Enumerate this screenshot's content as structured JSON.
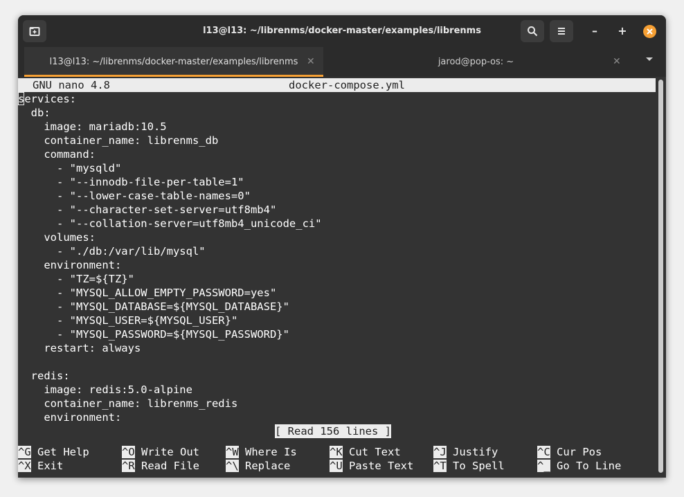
{
  "window": {
    "title": "l13@l13: ~/librenms/docker-master/examples/librenms",
    "accent": "#f6a034"
  },
  "titlebar_buttons": [
    "new-tab-icon",
    "search-icon",
    "menu-icon"
  ],
  "window_controls": {
    "minimize": "–",
    "maximize": "+"
  },
  "tabs": [
    {
      "label": "l13@l13: ~/librenms/docker-master/examples/librenms",
      "active": true
    },
    {
      "label": "jarod@pop-os: ~",
      "active": false
    }
  ],
  "nano": {
    "version_label": "GNU nano 4.8",
    "filename": "docker-compose.yml",
    "lines": [
      "services:",
      "  db:",
      "    image: mariadb:10.5",
      "    container_name: librenms_db",
      "    command:",
      "      - \"mysqld\"",
      "      - \"--innodb-file-per-table=1\"",
      "      - \"--lower-case-table-names=0\"",
      "      - \"--character-set-server=utf8mb4\"",
      "      - \"--collation-server=utf8mb4_unicode_ci\"",
      "    volumes:",
      "      - \"./db:/var/lib/mysql\"",
      "    environment:",
      "      - \"TZ=${TZ}\"",
      "      - \"MYSQL_ALLOW_EMPTY_PASSWORD=yes\"",
      "      - \"MYSQL_DATABASE=${MYSQL_DATABASE}\"",
      "      - \"MYSQL_USER=${MYSQL_USER}\"",
      "      - \"MYSQL_PASSWORD=${MYSQL_PASSWORD}\"",
      "    restart: always",
      "",
      "  redis:",
      "    image: redis:5.0-alpine",
      "    container_name: librenms_redis",
      "    environment:"
    ],
    "status": "[ Read 156 lines ]",
    "shortcuts_row1": [
      {
        "key": "^G",
        "label": "Get Help"
      },
      {
        "key": "^O",
        "label": "Write Out"
      },
      {
        "key": "^W",
        "label": "Where Is"
      },
      {
        "key": "^K",
        "label": "Cut Text"
      },
      {
        "key": "^J",
        "label": "Justify"
      },
      {
        "key": "^C",
        "label": "Cur Pos"
      }
    ],
    "shortcuts_row2": [
      {
        "key": "^X",
        "label": "Exit"
      },
      {
        "key": "^R",
        "label": "Read File"
      },
      {
        "key": "^\\",
        "label": "Replace"
      },
      {
        "key": "^U",
        "label": "Paste Text"
      },
      {
        "key": "^T",
        "label": "To Spell"
      },
      {
        "key": "^_",
        "label": "Go To Line"
      }
    ]
  }
}
